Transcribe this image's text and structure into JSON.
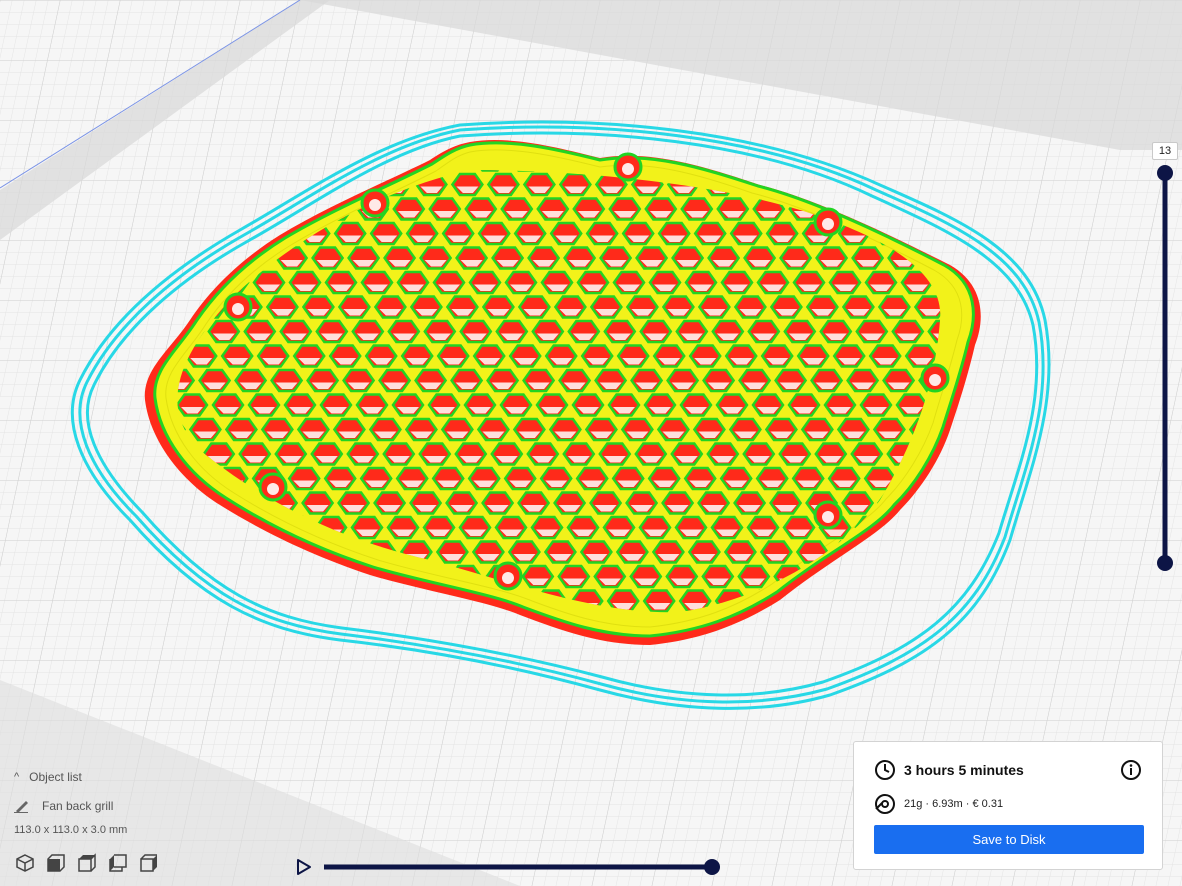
{
  "layer_slider": {
    "current_layer": "13"
  },
  "object_list": {
    "header_label": "Object list",
    "object_name": "Fan back grill",
    "dimensions": "113.0 x 113.0 x 3.0 mm"
  },
  "view_buttons": [
    {
      "icon": "3d-view-icon"
    },
    {
      "icon": "front-view-icon"
    },
    {
      "icon": "top-view-icon"
    },
    {
      "icon": "left-view-icon"
    },
    {
      "icon": "right-view-icon"
    }
  ],
  "print_info": {
    "time": "3 hours 5 minutes",
    "material": "21g · 6.93m · € 0.31",
    "save_label": "Save to Disk"
  },
  "colors": {
    "wall": "#ff2a1a",
    "top_skin": "#f2f21a",
    "inner_wall": "#22d422",
    "skirt": "#28d8e6",
    "accent": "#196ef0",
    "slider": "#0d1546"
  }
}
